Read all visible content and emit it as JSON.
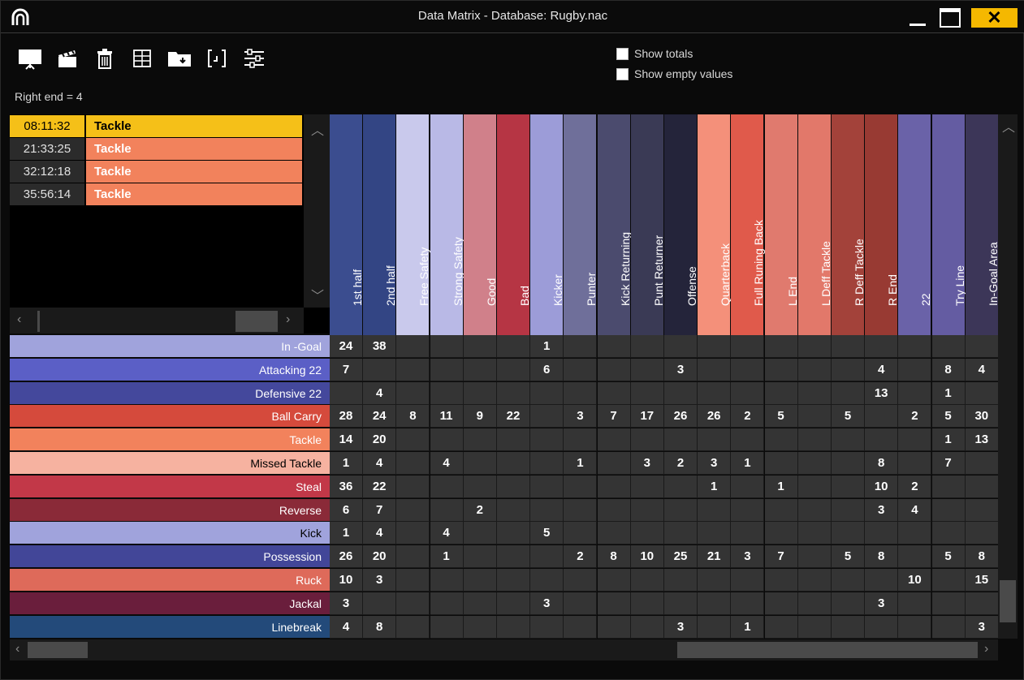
{
  "window": {
    "title": "Data Matrix - Database: Rugby.nac",
    "close_label": "✕"
  },
  "toolbar": {
    "tools": [
      "presentation-icon",
      "clapperboard-icon",
      "trash-icon",
      "table-icon",
      "folder-icon",
      "bracket-icon",
      "sliders-icon"
    ]
  },
  "options": {
    "show_totals": "Show totals",
    "show_empty": "Show empty values"
  },
  "status": "Right end = 4",
  "events": [
    {
      "time": "08:11:32",
      "label": "Tackle",
      "selected": true
    },
    {
      "time": "21:33:25",
      "label": "Tackle",
      "selected": false
    },
    {
      "time": "32:12:18",
      "label": "Tackle",
      "selected": false
    },
    {
      "time": "35:56:14",
      "label": "Tackle",
      "selected": false
    }
  ],
  "columns": [
    {
      "label": "1st half",
      "color": "#3b4d8f"
    },
    {
      "label": "2nd half",
      "color": "#334584"
    },
    {
      "label": "Free Safety",
      "color": "#c9c9ec"
    },
    {
      "label": "Strong Safety",
      "color": "#b9b9e6"
    },
    {
      "label": "Good",
      "color": "#d0808a"
    },
    {
      "label": "Bad",
      "color": "#b63544"
    },
    {
      "label": "Kicker",
      "color": "#9c9cd8"
    },
    {
      "label": "Punter",
      "color": "#6f6f9a"
    },
    {
      "label": "Kick Returning",
      "color": "#4b4b6e"
    },
    {
      "label": "Punt Returner",
      "color": "#3a3a55"
    },
    {
      "label": "Offense",
      "color": "#24243a"
    },
    {
      "label": "Quarterback",
      "color": "#f4907a"
    },
    {
      "label": "Full Runing Back",
      "color": "#e05a4b"
    },
    {
      "label": "L End",
      "color": "#e07a6e"
    },
    {
      "label": "L Deff Tackle",
      "color": "#e2786a"
    },
    {
      "label": "R Deff Tackle",
      "color": "#a3423a"
    },
    {
      "label": "R End",
      "color": "#983a33"
    },
    {
      "label": "22",
      "color": "#6a62a8"
    },
    {
      "label": "Try Line",
      "color": "#645ca2"
    },
    {
      "label": "In-Goal Area",
      "color": "#3c3658"
    }
  ],
  "rows": [
    {
      "label": "In -Goal",
      "color": "#a0a3dc",
      "text": "#ffffff",
      "values": [
        "24",
        "38",
        "",
        "",
        "",
        "",
        "1",
        "",
        "",
        "",
        "",
        "",
        "",
        "",
        "",
        "",
        "",
        "",
        "",
        ""
      ]
    },
    {
      "label": "Attacking 22",
      "color": "#5b5fc6",
      "text": "#ffffff",
      "values": [
        "7",
        "",
        "",
        "",
        "",
        "",
        "6",
        "",
        "",
        "",
        "3",
        "",
        "",
        "",
        "",
        "",
        "4",
        "",
        "8",
        "4"
      ]
    },
    {
      "label": "Defensive 22",
      "color": "#44489c",
      "text": "#ffffff",
      "values": [
        "",
        "4",
        "",
        "",
        "",
        "",
        "",
        "",
        "",
        "",
        "",
        "",
        "",
        "",
        "",
        "",
        "13",
        "",
        "1",
        ""
      ]
    },
    {
      "label": "Ball Carry",
      "color": "#d54a3c",
      "text": "#ffffff",
      "values": [
        "28",
        "24",
        "8",
        "11",
        "9",
        "22",
        "",
        "3",
        "7",
        "17",
        "26",
        "26",
        "2",
        "5",
        "",
        "5",
        "",
        "2",
        "5",
        "30"
      ]
    },
    {
      "label": "Tackle",
      "color": "#f2825c",
      "text": "#ffffff",
      "values": [
        "14",
        "20",
        "",
        "",
        "",
        "",
        "",
        "",
        "",
        "",
        "",
        "",
        "",
        "",
        "",
        "",
        "",
        "",
        "1",
        "13"
      ]
    },
    {
      "label": "Missed Tackle",
      "color": "#f6b2a0",
      "text": "#000000",
      "values": [
        "1",
        "4",
        "",
        "4",
        "",
        "",
        "",
        "1",
        "",
        "3",
        "2",
        "3",
        "1",
        "",
        "",
        "",
        "8",
        "",
        "7",
        ""
      ]
    },
    {
      "label": "Steal",
      "color": "#c23848",
      "text": "#ffffff",
      "values": [
        "36",
        "22",
        "",
        "",
        "",
        "",
        "",
        "",
        "",
        "",
        "",
        "1",
        "",
        "1",
        "",
        "",
        "10",
        "2",
        "",
        ""
      ]
    },
    {
      "label": "Reverse",
      "color": "#8a2a38",
      "text": "#ffffff",
      "values": [
        "6",
        "7",
        "",
        "",
        "2",
        "",
        "",
        "",
        "",
        "",
        "",
        "",
        "",
        "",
        "",
        "",
        "3",
        "4",
        "",
        ""
      ]
    },
    {
      "label": "Kick",
      "color": "#a0a3dc",
      "text": "#000000",
      "values": [
        "1",
        "4",
        "",
        "4",
        "",
        "",
        "5",
        "",
        "",
        "",
        "",
        "",
        "",
        "",
        "",
        "",
        "",
        "",
        "",
        ""
      ]
    },
    {
      "label": "Possession",
      "color": "#424698",
      "text": "#ffffff",
      "values": [
        "26",
        "20",
        "",
        "1",
        "",
        "",
        "",
        "2",
        "8",
        "10",
        "25",
        "21",
        "3",
        "7",
        "",
        "5",
        "8",
        "",
        "5",
        "8"
      ]
    },
    {
      "label": "Ruck",
      "color": "#de6a5a",
      "text": "#ffffff",
      "values": [
        "10",
        "3",
        "",
        "",
        "",
        "",
        "",
        "",
        "",
        "",
        "",
        "",
        "",
        "",
        "",
        "",
        "",
        "10",
        "",
        "15"
      ]
    },
    {
      "label": "Jackal",
      "color": "#6a1e3c",
      "text": "#ffffff",
      "values": [
        "3",
        "",
        "",
        "",
        "",
        "",
        "3",
        "",
        "",
        "",
        "",
        "",
        "",
        "",
        "",
        "",
        "3",
        "",
        "",
        ""
      ]
    },
    {
      "label": "Linebreak",
      "color": "#234a7a",
      "text": "#ffffff",
      "values": [
        "4",
        "8",
        "",
        "",
        "",
        "",
        "",
        "",
        "",
        "",
        "3",
        "",
        "1",
        "",
        "",
        "",
        "",
        "",
        "",
        "3"
      ]
    }
  ]
}
